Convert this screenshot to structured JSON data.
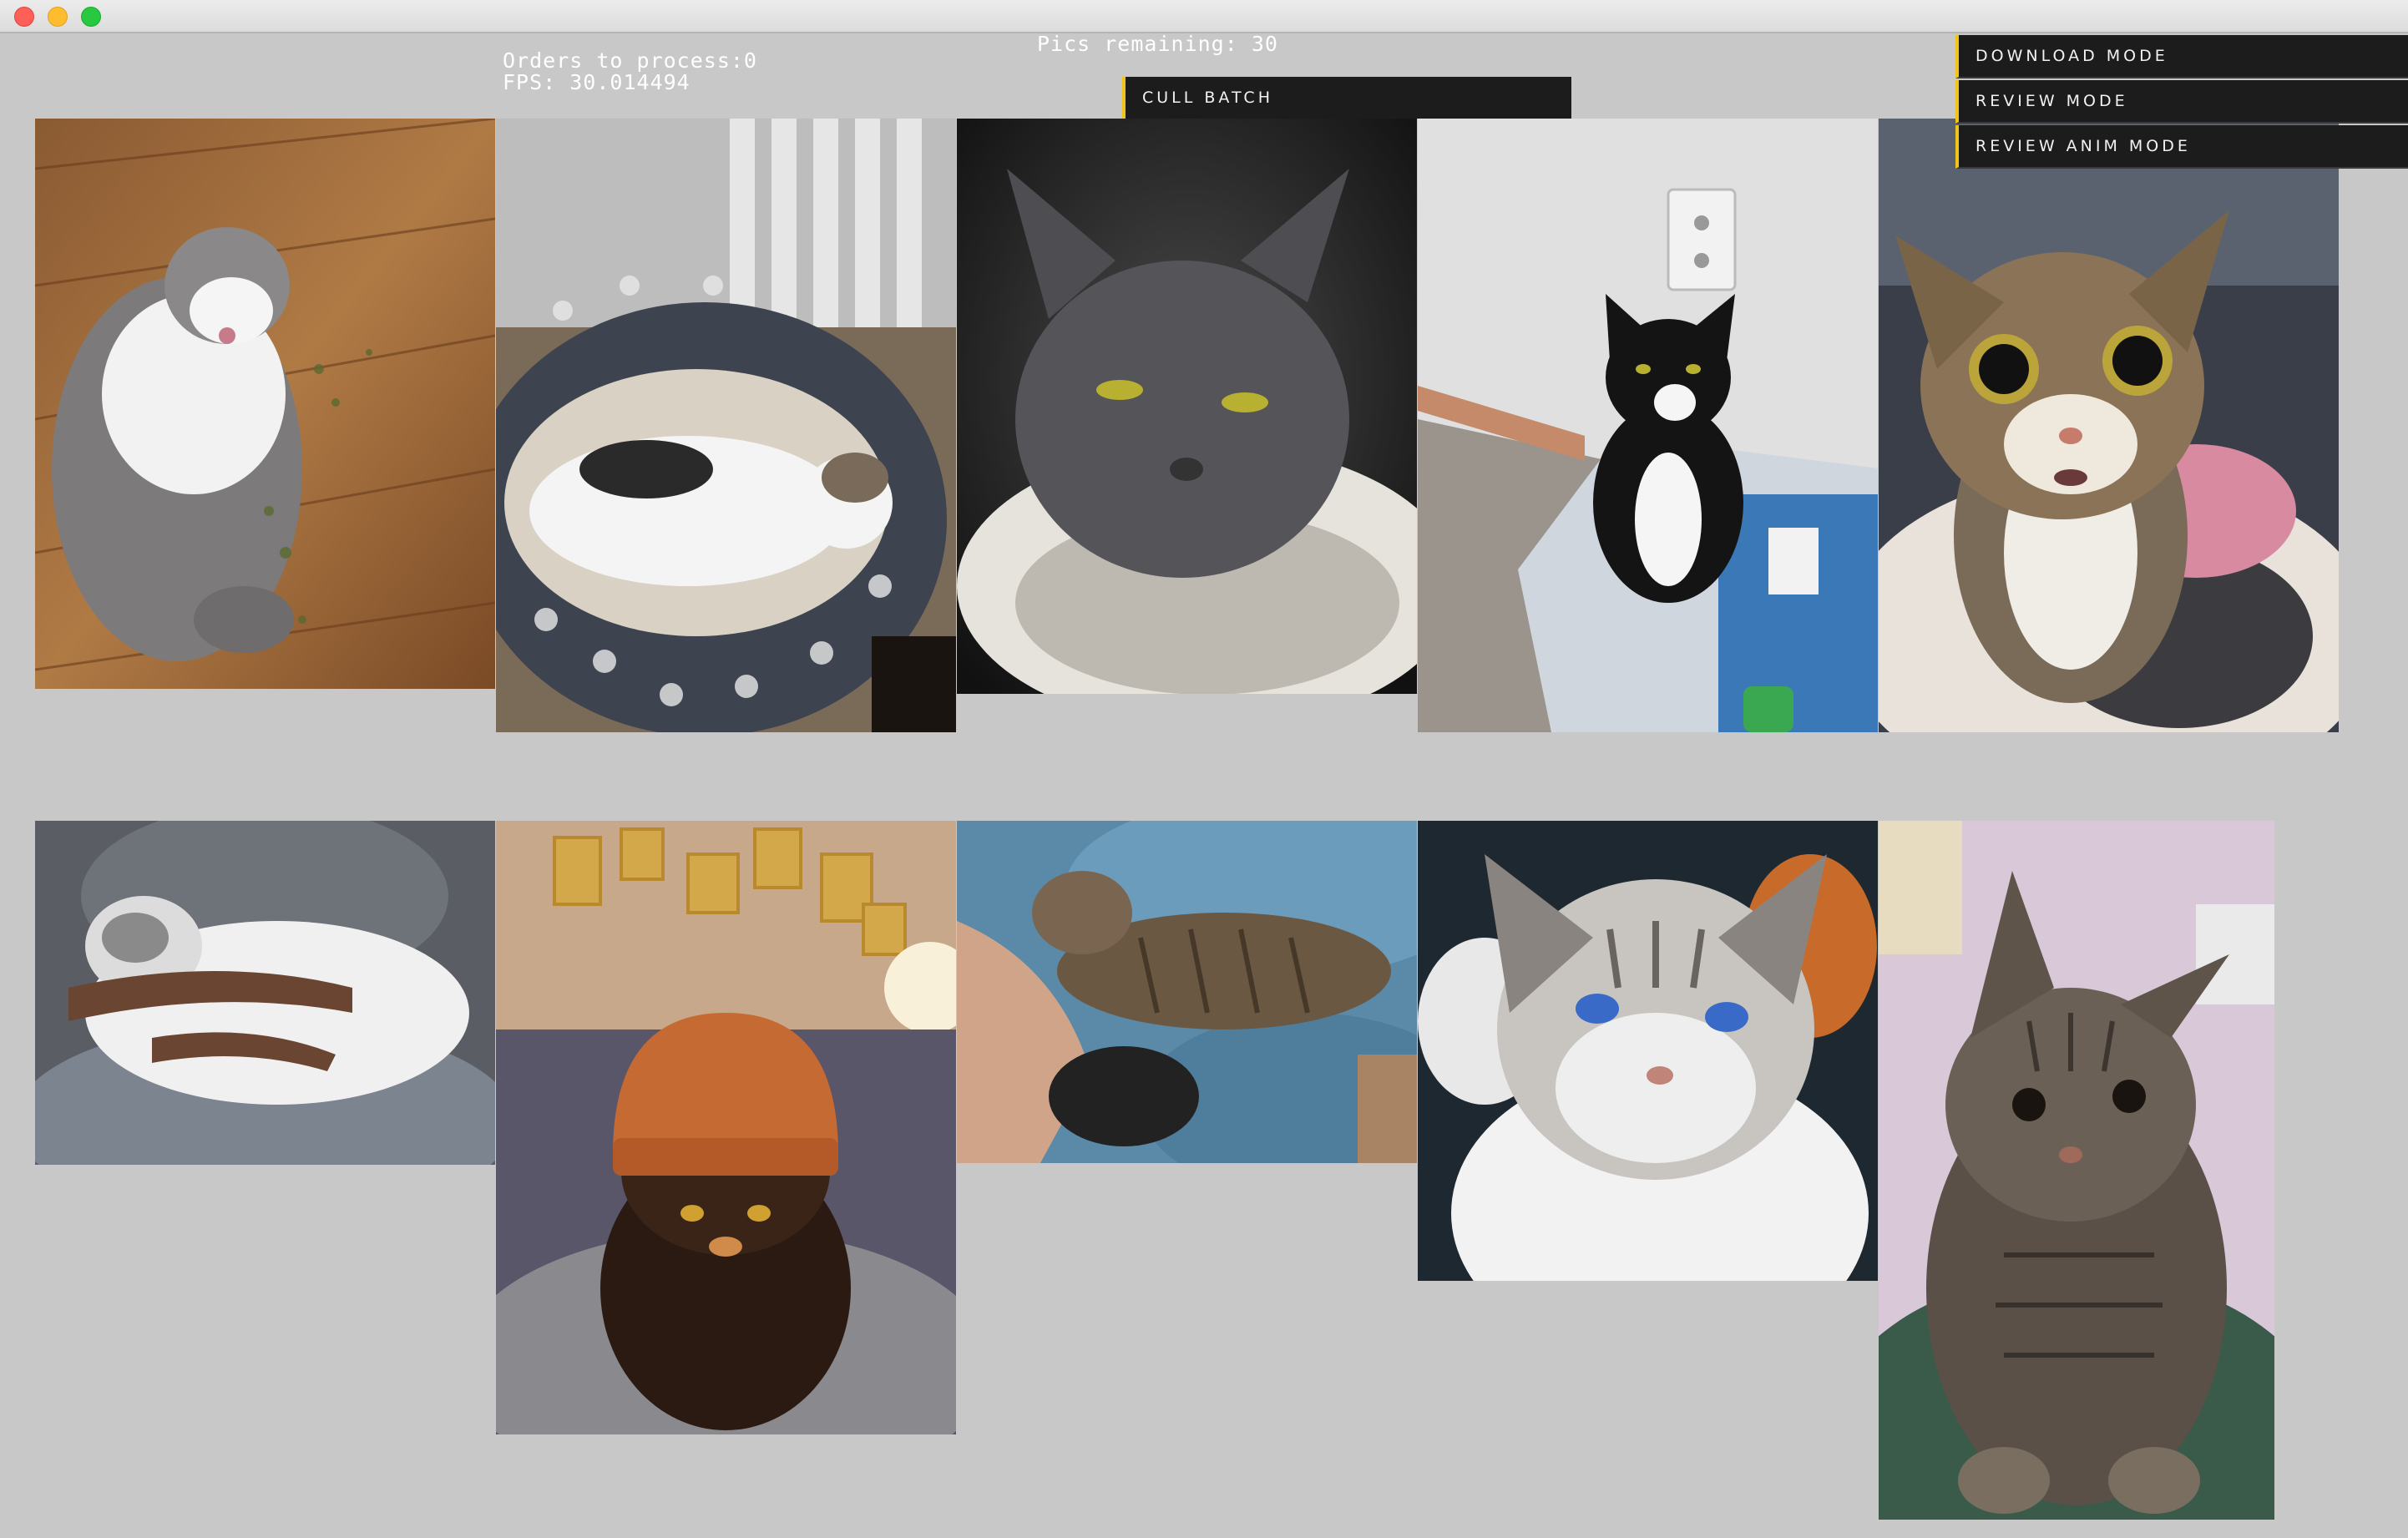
{
  "hud": {
    "orders_line": "Orders to process:0",
    "fps_line": "FPS: 30.014494",
    "remaining_line": "Pics remaining: 30"
  },
  "buttons": {
    "cull_batch": "CULL BATCH",
    "download_mode": "DOWNLOAD MODE",
    "review_mode": "REVIEW MODE",
    "review_anim_mode": "REVIEW ANIM MODE"
  },
  "colors": {
    "background": "#c8c8c8",
    "button_bg": "#1c1c1c",
    "button_accent": "#f0c419",
    "hud_text": "#ffffff"
  },
  "photos": [
    {
      "subject": "grey-white cat lying on wooden floor with catnip",
      "icon": "cat-photo"
    },
    {
      "subject": "calico cat lying in patterned cat bed",
      "icon": "cat-photo"
    },
    {
      "subject": "grey cat in fluffy bed, dark background",
      "icon": "cat-photo"
    },
    {
      "subject": "tuxedo cat sitting on water bottles",
      "icon": "cat-photo"
    },
    {
      "subject": "tabby-white cat with wide eyes",
      "icon": "cat-photo"
    },
    {
      "subject": "white cat held in arms",
      "icon": "cat-photo"
    },
    {
      "subject": "tortoiseshell cat wearing orange beanie",
      "icon": "cat-photo"
    },
    {
      "subject": "tabby cat lying on arm on blue blanket",
      "icon": "cat-photo"
    },
    {
      "subject": "fluffy blue-eyed cat",
      "icon": "cat-photo"
    },
    {
      "subject": "tabby kitten lying on green blanket",
      "icon": "cat-photo"
    }
  ]
}
